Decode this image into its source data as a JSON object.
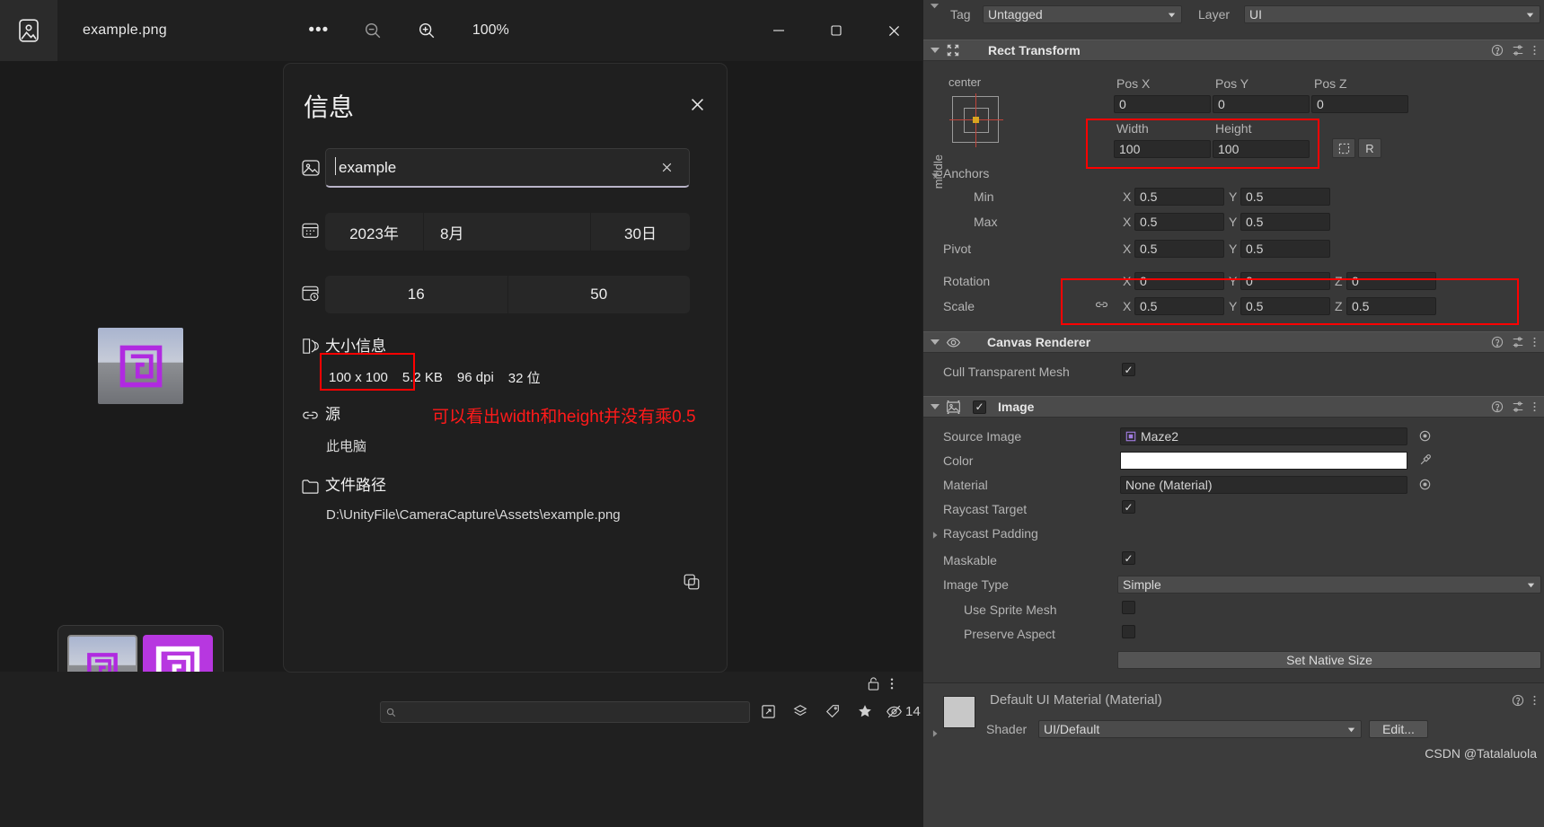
{
  "photos": {
    "app_icon": "photo-icon",
    "title": "example.png",
    "more_label": "•••",
    "zoom_out_icon": "zoom-out-icon",
    "zoom_in_icon": "zoom-in-icon",
    "zoom_level": "100%",
    "minimize": "—",
    "maximize": "▢",
    "close": "✕",
    "bottom_search_placeholder": "",
    "bottom_count": "14"
  },
  "info": {
    "title": "信息",
    "close_icon": "close-icon",
    "name_icon": "image-icon",
    "name_value": "example",
    "name_clear_icon": "clear-icon",
    "date_icon": "calendar-icon",
    "date_year": "2023年",
    "date_month": "8月",
    "date_day": "30日",
    "time_icon": "clock-icon",
    "time_hour": "16",
    "time_minute": "50",
    "size_icon": "dimensions-icon",
    "size_label": "大小信息",
    "size_dimensions": "100 x 100",
    "size_filesize": "5.2 KB",
    "size_dpi": "96 dpi",
    "size_bitdepth": "32 位",
    "source_icon": "link-icon",
    "source_label": "源",
    "source_value": "此电脑",
    "path_icon": "folder-icon",
    "path_label": "文件路径",
    "path_value": "D:\\UnityFile\\CameraCapture\\Assets\\example.png",
    "copy_icon": "copy-icon",
    "annotation": "可以看出width和height并没有乘0.5",
    "annotation_color": "#ff1a1a"
  },
  "inspector": {
    "tag_label": "Tag",
    "tag_value": "Untagged",
    "layer_label": "Layer",
    "layer_value": "UI",
    "rect_transform": {
      "title": "Rect Transform",
      "icon": "rect-transform-icon",
      "anchor_preset_h": "center",
      "anchor_preset_v": "middle",
      "pos_x_label": "Pos X",
      "pos_y_label": "Pos Y",
      "pos_z_label": "Pos Z",
      "pos_x": "0",
      "pos_y": "0",
      "pos_z": "0",
      "width_label": "Width",
      "height_label": "Height",
      "width": "100",
      "height": "100",
      "anchors_label": "Anchors",
      "min_label": "Min",
      "max_label": "Max",
      "pivot_label": "Pivot",
      "min_x": "0.5",
      "min_y": "0.5",
      "max_x": "0.5",
      "max_y": "0.5",
      "pivot_x": "0.5",
      "pivot_y": "0.5",
      "rotation_label": "Rotation",
      "rot_x": "0",
      "rot_y": "0",
      "rot_z": "0",
      "scale_label": "Scale",
      "scale_x": "0.5",
      "scale_y": "0.5",
      "scale_z": "0.5",
      "axis_x": "X",
      "axis_y": "Y",
      "axis_z": "Z",
      "blueprint_icon": "blueprint-mode-icon",
      "raw_icon": "R"
    },
    "canvas_renderer": {
      "title": "Canvas Renderer",
      "icon": "eye-icon",
      "cull_label": "Cull Transparent Mesh",
      "cull_checked": "✓"
    },
    "image": {
      "title": "Image",
      "icon": "image-component-icon",
      "enabled": "✓",
      "source_image_label": "Source Image",
      "source_image_value": "Maze2",
      "color_label": "Color",
      "color_value": "#FFFFFF",
      "material_label": "Material",
      "material_value": "None (Material)",
      "raycast_target_label": "Raycast Target",
      "raycast_target_checked": "✓",
      "raycast_padding_label": "Raycast Padding",
      "maskable_label": "Maskable",
      "maskable_checked": "✓",
      "image_type_label": "Image Type",
      "image_type_value": "Simple",
      "use_sprite_mesh_label": "Use Sprite Mesh",
      "preserve_aspect_label": "Preserve Aspect",
      "set_native_size_label": "Set Native Size"
    },
    "material_footer": {
      "title": "Default UI Material (Material)",
      "shader_label": "Shader",
      "shader_value": "UI/Default",
      "edit_label": "Edit..."
    },
    "watermark": "CSDN @Tatalaluola"
  }
}
